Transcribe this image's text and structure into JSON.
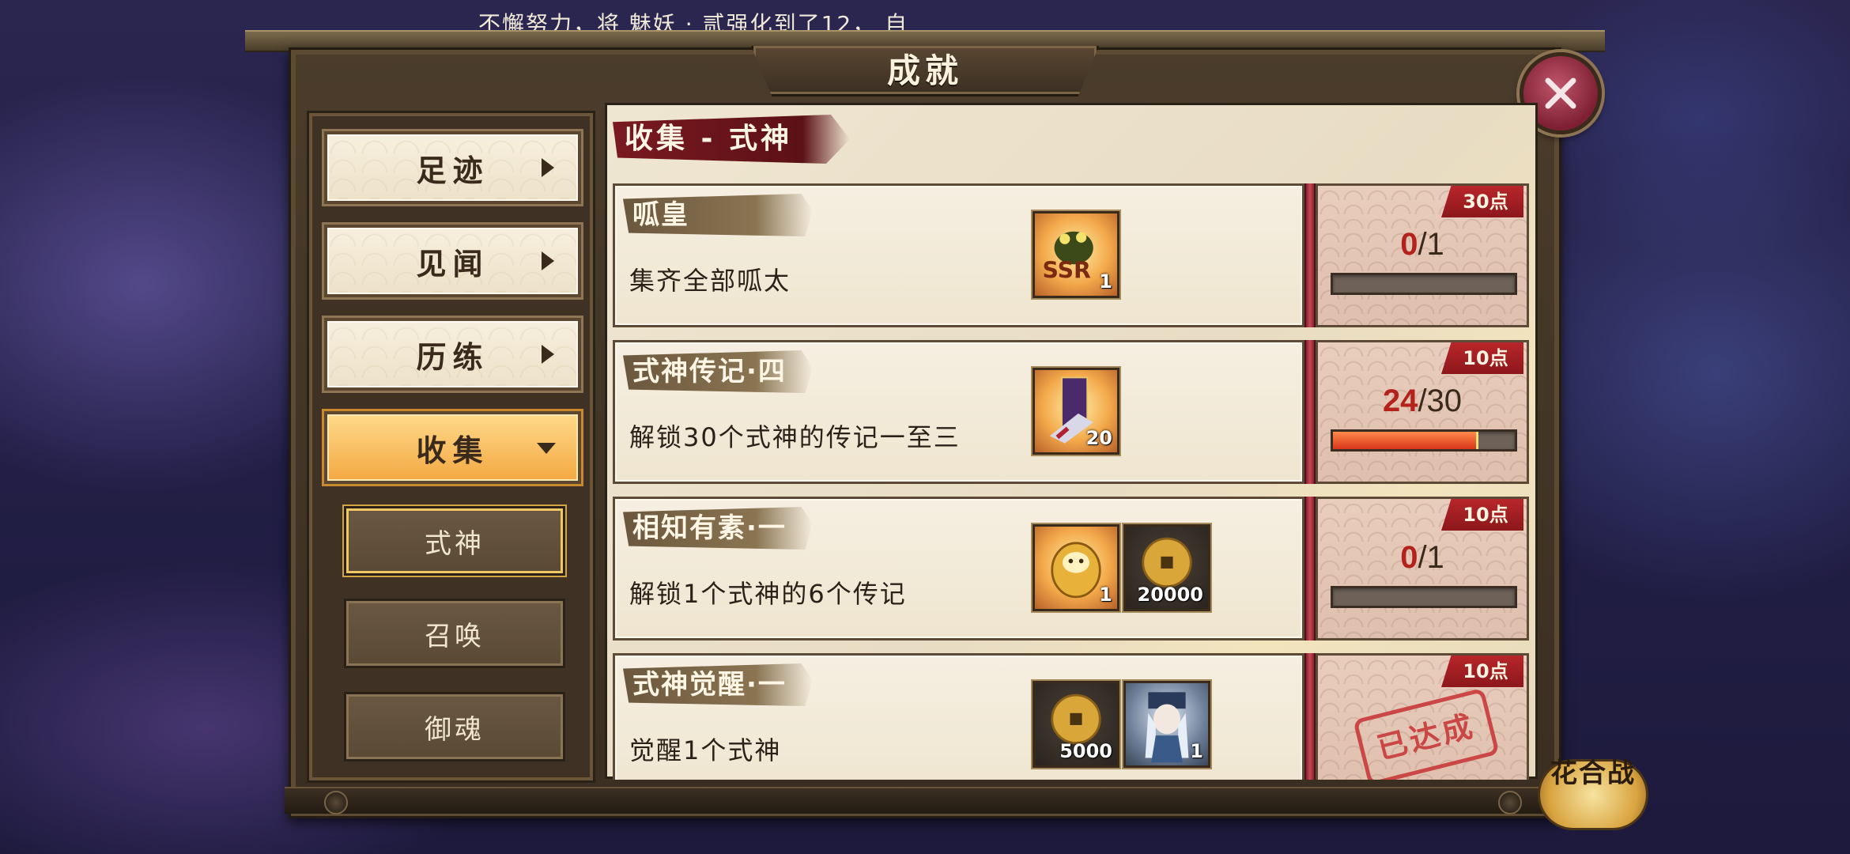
{
  "marquee": "不懈努力，将 魅妖 · 贰强化到了12， 自",
  "title": "成就",
  "close_icon": "close-x-icon",
  "categories": [
    {
      "label": "足迹",
      "active": false
    },
    {
      "label": "见闻",
      "active": false
    },
    {
      "label": "历练",
      "active": false
    },
    {
      "label": "收集",
      "active": true
    }
  ],
  "subcategories": [
    {
      "label": "式神",
      "active": true
    },
    {
      "label": "召唤",
      "active": false
    },
    {
      "label": "御魂",
      "active": false
    }
  ],
  "section_header": "收集 - 式神",
  "achievements": [
    {
      "title": "呱皇",
      "description": "集齐全部呱太",
      "rewards": [
        {
          "icon": "ssr-frog-icon",
          "count": "1",
          "style": "orange"
        }
      ],
      "points": "30点",
      "progress_current": "0",
      "progress_total": "/1",
      "progress_fraction": 0,
      "completed": false
    },
    {
      "title": "式神传记·四",
      "description": "解锁30个式神的传记一至三",
      "rewards": [
        {
          "icon": "skill-scroll-icon",
          "count": "20",
          "style": "orange"
        }
      ],
      "points": "10点",
      "progress_current": "24",
      "progress_total": "/30",
      "progress_fraction": 0.8,
      "completed": false
    },
    {
      "title": "相知有素·一",
      "description": "解锁1个式神的6个传记",
      "rewards": [
        {
          "icon": "gold-daruma-icon",
          "count": "1",
          "style": "orange"
        },
        {
          "icon": "gold-coin-icon",
          "count": "20000",
          "style": "dark"
        }
      ],
      "points": "10点",
      "progress_current": "0",
      "progress_total": "/1",
      "progress_fraction": 0,
      "completed": false
    },
    {
      "title": "式神觉醒·一",
      "description": "觉醒1个式神",
      "rewards": [
        {
          "icon": "gold-coin-icon",
          "count": "5000",
          "style": "dark"
        },
        {
          "icon": "shikigami-portrait-icon",
          "count": "1",
          "style": "blue"
        }
      ],
      "points": "10点",
      "completed": true,
      "stamp": "已达成"
    }
  ],
  "hanafuda_button": "花合战",
  "colors": {
    "accent_red": "#b3231c",
    "tab_active": "#f3a842",
    "panel": "#efe6d2"
  }
}
